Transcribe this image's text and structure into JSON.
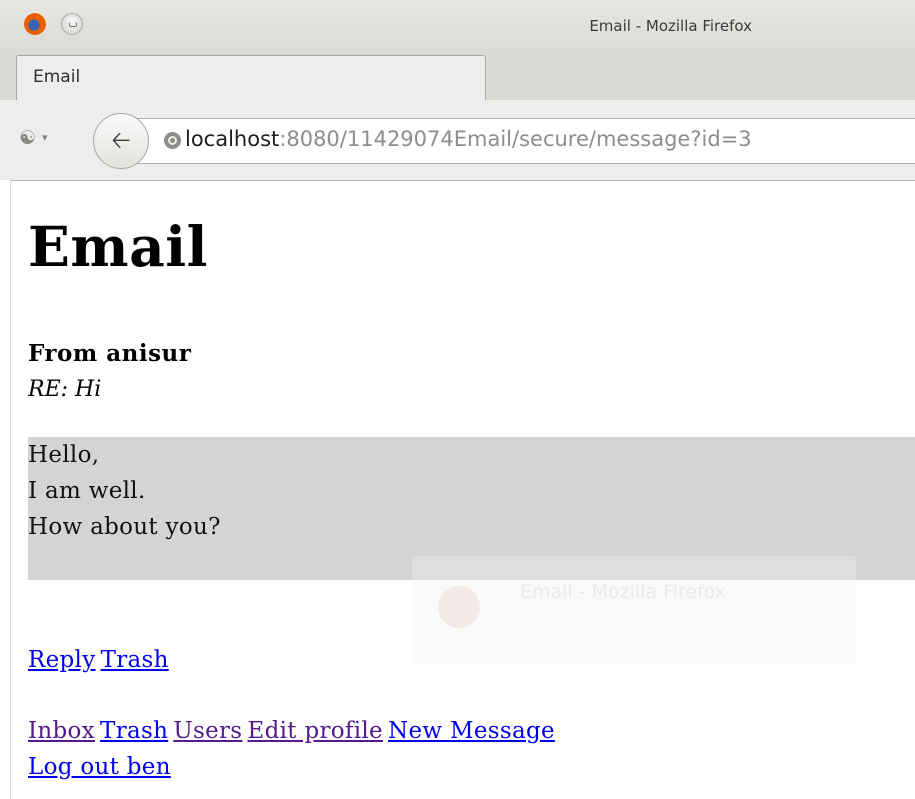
{
  "window": {
    "title": "Email - Mozilla Firefox"
  },
  "tab": {
    "label": "Email"
  },
  "url": {
    "host": "localhost",
    "rest": ":8080/11429074Email/secure/message?id=3"
  },
  "page": {
    "heading": "Email",
    "from": "From anisur",
    "subject": "RE: Hi",
    "body_lines": [
      "Hello,",
      "I am well.",
      "How about you?"
    ],
    "actions": {
      "reply": "Reply",
      "trash": "Trash"
    },
    "nav": {
      "inbox": "Inbox",
      "trash": "Trash",
      "users": "Users",
      "edit_profile": "Edit profile",
      "new_message": "New Message",
      "logout": "Log out ben"
    },
    "ghost_notification": "Email - Mozilla Firefox"
  },
  "colors": {
    "link": "#0000ee",
    "visited_link": "#551a8b",
    "body_bg": "#d4d4d4"
  }
}
